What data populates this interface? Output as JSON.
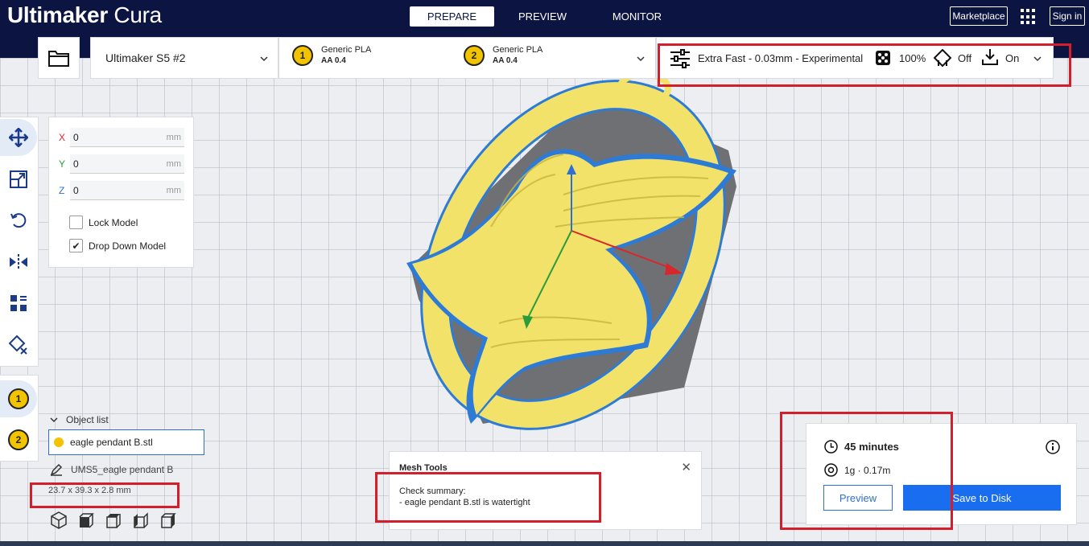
{
  "app": {
    "brand_bold": "Ultimaker",
    "brand_light": "Cura"
  },
  "stages": [
    "PREPARE",
    "PREVIEW",
    "MONITOR"
  ],
  "header_right": {
    "marketplace": "Marketplace",
    "signin": "Sign in"
  },
  "printer": {
    "name": "Ultimaker S5 #2"
  },
  "extruders": [
    {
      "number": "1",
      "material": "Generic PLA",
      "nozzle": "AA 0.4"
    },
    {
      "number": "2",
      "material": "Generic PLA",
      "nozzle": "AA 0.4"
    }
  ],
  "print_settings": {
    "profile": "Extra Fast - 0.03mm - Experimental",
    "infill": "100%",
    "support": "Off",
    "adhesion": "On"
  },
  "move_panel": {
    "x": {
      "label": "X",
      "value": "0",
      "unit": "mm"
    },
    "y": {
      "label": "Y",
      "value": "0",
      "unit": "mm"
    },
    "z": {
      "label": "Z",
      "value": "0",
      "unit": "mm"
    },
    "lock_model": {
      "label": "Lock Model",
      "checked": false
    },
    "drop_down": {
      "label": "Drop Down Model",
      "checked": true
    }
  },
  "object_list": {
    "header": "Object list",
    "item": "eagle pendant B.stl",
    "job_name": "UMS5_eagle pendant B",
    "dimensions": "23.7 x 39.3 x 2.8 mm"
  },
  "mesh_tools": {
    "title": "Mesh Tools",
    "line1": "Check summary:",
    "line2": "- eagle pendant B.stl is watertight"
  },
  "print_panel": {
    "time": "45 minutes",
    "material": "1g · 0.17m",
    "preview_label": "Preview",
    "save_label": "Save to Disk"
  },
  "colors": {
    "topbar": "#0c1541",
    "model_yellow": "#f2e26a",
    "model_outline": "#2e7bd6",
    "accent_blue": "#196ef0",
    "annotation_red": "#d21f2b",
    "extruder_yellow": "#f2c400"
  }
}
